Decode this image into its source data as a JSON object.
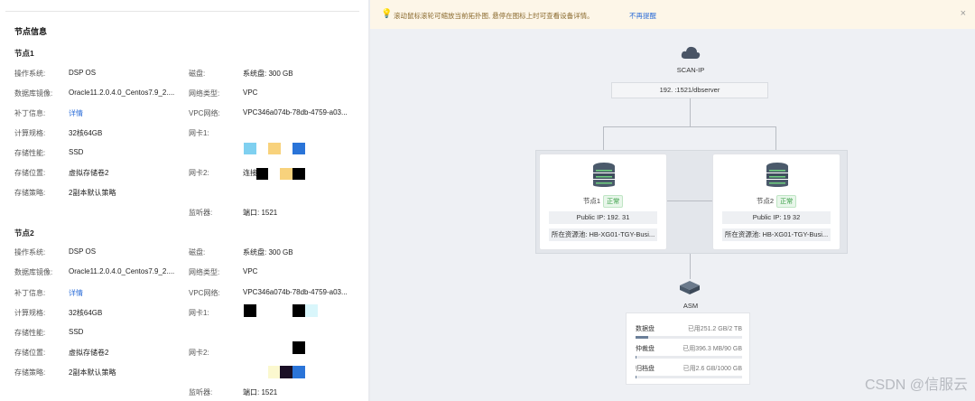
{
  "left": {
    "section_title": "节点信息",
    "nodes": [
      {
        "title": "节点1",
        "os_label": "操作系统:",
        "os": "DSP OS",
        "image_label": "数据库镜像:",
        "image": "Oracle11.2.0.4.0_Centos7.9_2....",
        "patch_label": "补丁信息:",
        "patch": "详情",
        "spec_label": "计算规格:",
        "spec": "32核64GB",
        "perf_label": "存储性能:",
        "perf": "SSD",
        "loc_label": "存储位置:",
        "loc": "虚拟存储卷2",
        "policy_label": "存储策略:",
        "policy": "2副本默认策略",
        "disk_label": "磁盘:",
        "disk": "系统盘: 300 GB",
        "nettype_label": "网络类型:",
        "nettype": "VPC",
        "vpc_label": "VPC网络:",
        "vpc": "VPC346a074b-78db-4759-a03...",
        "nic1_label": "网卡1:",
        "nic1": "",
        "nic2_label": "网卡2:",
        "nic2": "连接",
        "listener_label": "监听器:",
        "listener": "端口: 1521"
      },
      {
        "title": "节点2",
        "os_label": "操作系统:",
        "os": "DSP OS",
        "image_label": "数据库镜像:",
        "image": "Oracle11.2.0.4.0_Centos7.9_2....",
        "patch_label": "补丁信息:",
        "patch": "详情",
        "spec_label": "计算规格:",
        "spec": "32核64GB",
        "perf_label": "存储性能:",
        "perf": "SSD",
        "loc_label": "存储位置:",
        "loc": "虚拟存储卷2",
        "policy_label": "存储策略:",
        "policy": "2副本默认策略",
        "disk_label": "磁盘:",
        "disk": "系统盘: 300 GB",
        "nettype_label": "网络类型:",
        "nettype": "VPC",
        "vpc_label": "VPC网络:",
        "vpc": "VPC346a074b-78db-4759-a03...",
        "nic1_label": "网卡1:",
        "nic1": "",
        "nic2_label": "网卡2:",
        "nic2": "",
        "listener_label": "监听器:",
        "listener": "端口: 1521"
      }
    ]
  },
  "tip": {
    "text": "滚动鼠标滚轮可缩放当前拓扑图, 悬停在图标上时可查看设备详情。",
    "link": "不再提醒",
    "close": "×"
  },
  "topology": {
    "scan_label": "SCAN-IP",
    "scan_value": "192.           :1521/dbserver",
    "node_cards": [
      {
        "name": "节点1",
        "status": "正常",
        "ip": "Public IP: 192.            31",
        "pool": "所在资源池: HB-XG01-TGY-Busi..."
      },
      {
        "name": "节点2",
        "status": "正常",
        "ip": "Public IP: 19              32",
        "pool": "所在资源池: HB-XG01-TGY-Busi..."
      }
    ],
    "asm_label": "ASM",
    "storage": [
      {
        "name": "数据盘",
        "usage": "已用251.2 GB/2 TB",
        "fill": 0.12
      },
      {
        "name": "仲裁盘",
        "usage": "已用396.3 MB/90 GB",
        "fill": 0.005
      },
      {
        "name": "归档盘",
        "usage": "已用2.6 GB/1000 GB",
        "fill": 0.003
      }
    ]
  },
  "watermark": "CSDN @信服云"
}
